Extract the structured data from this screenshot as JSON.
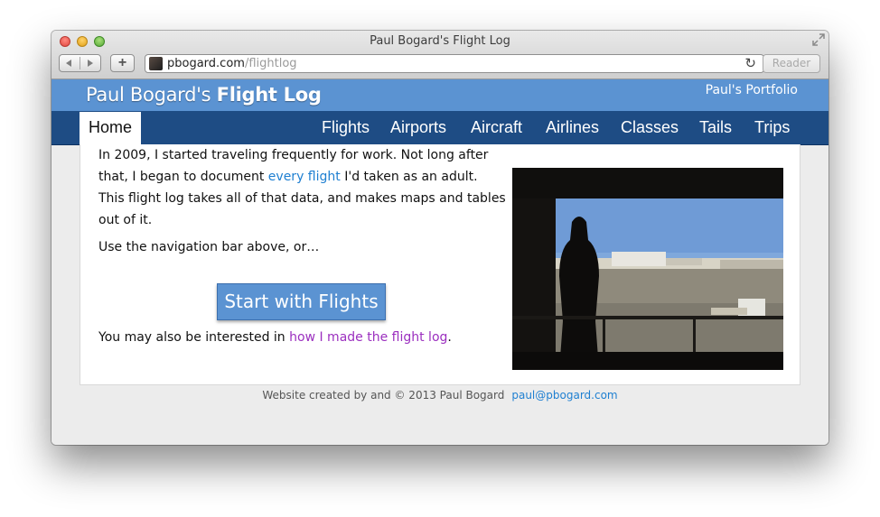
{
  "window": {
    "title": "Paul Bogard's Flight Log",
    "url_domain": "pbogard.com",
    "url_path": "/flightlog",
    "reader_label": "Reader",
    "new_tab_label": "+",
    "reload_glyph": "↻"
  },
  "site": {
    "title_light": "Paul Bogard's",
    "title_strong": "Flight Log",
    "portfolio_link": "Paul's Portfolio"
  },
  "nav": {
    "home": "Home",
    "items": [
      "Flights",
      "Airports",
      "Aircraft",
      "Airlines",
      "Classes",
      "Tails",
      "Trips"
    ]
  },
  "content": {
    "intro_before": "In 2009, I started traveling frequently for work. Not long after that, I began to document ",
    "intro_link": "every flight",
    "intro_after": " I'd taken as an adult. This flight log takes all of that data, and makes maps and tables out of it.",
    "nav_hint": "Use the navigation bar above, or…",
    "cta_label": "Start with Flights",
    "also_before": "You may also be interested in ",
    "also_link": "how I made the flight log",
    "also_after": "."
  },
  "footer": {
    "text": "Website created by and © 2013 Paul Bogard",
    "email": "paul@pbogard.com"
  },
  "colors": {
    "header_blue": "#5b93d2",
    "nav_dark_blue": "#1e4c84",
    "link_blue": "#1e7fd1",
    "visited_purple": "#9b2fbf"
  }
}
